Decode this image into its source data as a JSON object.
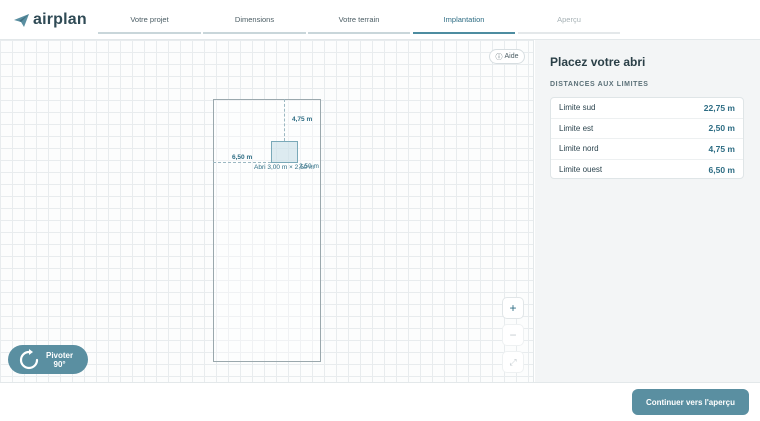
{
  "brand": {
    "name": "airplan"
  },
  "steps": [
    {
      "label": "Votre projet",
      "state": "done"
    },
    {
      "label": "Dimensions",
      "state": "done"
    },
    {
      "label": "Votre terrain",
      "state": "done"
    },
    {
      "label": "Implantation",
      "state": "active"
    },
    {
      "label": "Aperçu",
      "state": "future"
    }
  ],
  "canvas": {
    "help_label": "Aide",
    "dim_top": "4,75 m",
    "dim_left": "6,50 m",
    "abri_label": "Abri 3,00 m × 2,50 m",
    "abri_right": "2,50 m",
    "zoom_in": "+",
    "zoom_out": "−",
    "fit": "⤢",
    "rotate_label": "Pivoter",
    "rotate_angle": "90°"
  },
  "panel": {
    "title": "Placez votre abri",
    "subtitle": "DISTANCES AUX LIMITES",
    "distances": [
      {
        "name": "Limite sud",
        "value": "22,75 m"
      },
      {
        "name": "Limite est",
        "value": "2,50 m"
      },
      {
        "name": "Limite nord",
        "value": "4,75 m"
      },
      {
        "name": "Limite ouest",
        "value": "6,50 m"
      }
    ]
  },
  "footer": {
    "continue_label": "Continuer vers l'aperçu"
  },
  "colors": {
    "accent": "#5a8fa1",
    "accent_text": "#2e6d84",
    "ink": "#2e4650"
  }
}
